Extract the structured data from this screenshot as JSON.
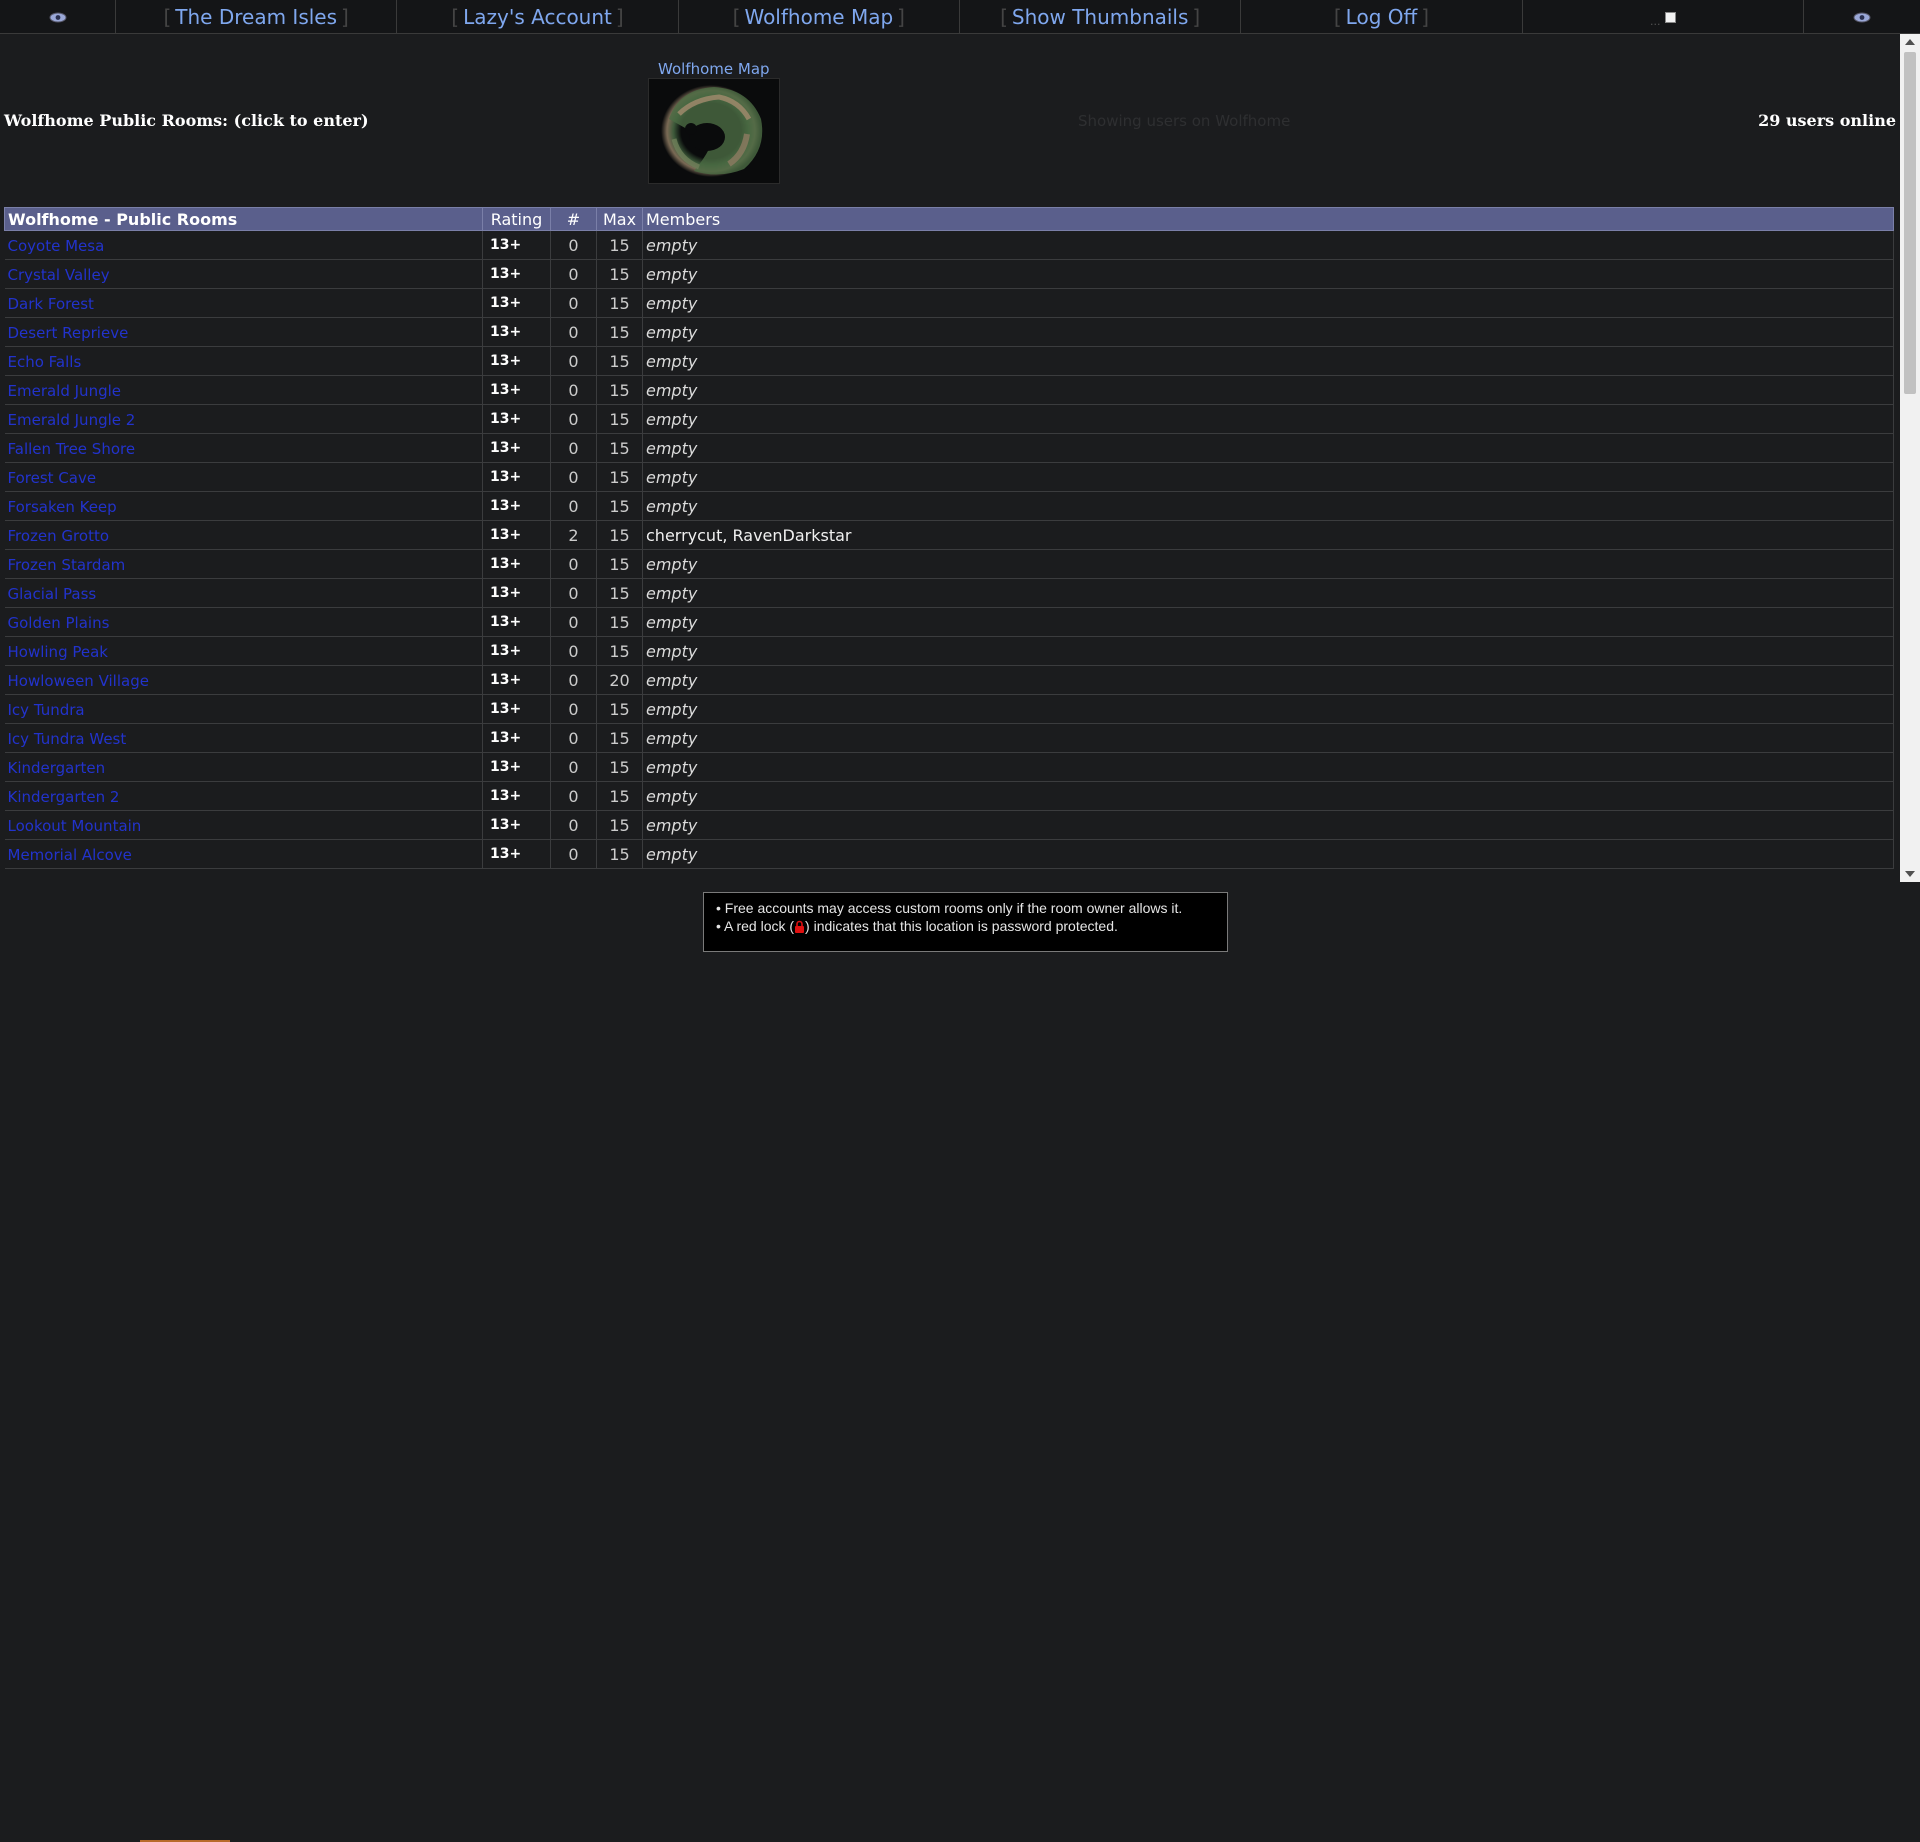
{
  "nav": {
    "items": [
      {
        "label": "The Dream Isles"
      },
      {
        "label": "Lazy's Account"
      },
      {
        "label": "Wolfhome Map"
      },
      {
        "label": "Show Thumbnails"
      },
      {
        "label": "Log Off"
      }
    ],
    "left_icon": "eye-icon",
    "right_icon": "eye-icon",
    "checkbox_dots": "..."
  },
  "header": {
    "public_rooms_title": "Wolfhome Public Rooms: (click to enter)",
    "map_link": "Wolfhome Map",
    "showing_text": "Showing users on Wolfhome",
    "users_online": "29 users online"
  },
  "table": {
    "columns": [
      "Wolfhome - Public Rooms",
      "Rating",
      "#",
      "Max",
      "Members"
    ],
    "rows": [
      {
        "name": "Coyote Mesa",
        "rating": "13+",
        "count": "0",
        "max": "15",
        "members": "empty"
      },
      {
        "name": "Crystal Valley",
        "rating": "13+",
        "count": "0",
        "max": "15",
        "members": "empty"
      },
      {
        "name": "Dark Forest",
        "rating": "13+",
        "count": "0",
        "max": "15",
        "members": "empty"
      },
      {
        "name": "Desert Reprieve",
        "rating": "13+",
        "count": "0",
        "max": "15",
        "members": "empty"
      },
      {
        "name": "Echo Falls",
        "rating": "13+",
        "count": "0",
        "max": "15",
        "members": "empty"
      },
      {
        "name": "Emerald Jungle",
        "rating": "13+",
        "count": "0",
        "max": "15",
        "members": "empty"
      },
      {
        "name": "Emerald Jungle 2",
        "rating": "13+",
        "count": "0",
        "max": "15",
        "members": "empty"
      },
      {
        "name": "Fallen Tree Shore",
        "rating": "13+",
        "count": "0",
        "max": "15",
        "members": "empty"
      },
      {
        "name": "Forest Cave",
        "rating": "13+",
        "count": "0",
        "max": "15",
        "members": "empty"
      },
      {
        "name": "Forsaken Keep",
        "rating": "13+",
        "count": "0",
        "max": "15",
        "members": "empty"
      },
      {
        "name": "Frozen Grotto",
        "rating": "13+",
        "count": "2",
        "max": "15",
        "members": "cherrycut, RavenDarkstar"
      },
      {
        "name": "Frozen Stardam",
        "rating": "13+",
        "count": "0",
        "max": "15",
        "members": "empty"
      },
      {
        "name": "Glacial Pass",
        "rating": "13+",
        "count": "0",
        "max": "15",
        "members": "empty"
      },
      {
        "name": "Golden Plains",
        "rating": "13+",
        "count": "0",
        "max": "15",
        "members": "empty"
      },
      {
        "name": "Howling Peak",
        "rating": "13+",
        "count": "0",
        "max": "15",
        "members": "empty"
      },
      {
        "name": "Howloween Village",
        "rating": "13+",
        "count": "0",
        "max": "20",
        "members": "empty"
      },
      {
        "name": "Icy Tundra",
        "rating": "13+",
        "count": "0",
        "max": "15",
        "members": "empty"
      },
      {
        "name": "Icy Tundra West",
        "rating": "13+",
        "count": "0",
        "max": "15",
        "members": "empty"
      },
      {
        "name": "Kindergarten",
        "rating": "13+",
        "count": "0",
        "max": "15",
        "members": "empty"
      },
      {
        "name": "Kindergarten 2",
        "rating": "13+",
        "count": "0",
        "max": "15",
        "members": "empty"
      },
      {
        "name": "Lookout Mountain",
        "rating": "13+",
        "count": "0",
        "max": "15",
        "members": "empty"
      },
      {
        "name": "Memorial Alcove",
        "rating": "13+",
        "count": "0",
        "max": "15",
        "members": "empty"
      }
    ]
  },
  "notes": {
    "line1": "• Free accounts may access custom rooms only if the room owner allows it.",
    "line2_prefix": "• A red lock (",
    "line2_suffix": ") indicates that this location is password protected.",
    "lock_icon": "lock-icon",
    "lock_color": "#e01010"
  },
  "colors": {
    "link": "#7fa7ee",
    "room_link": "#2233cc",
    "header_bg": "#5a5f8c",
    "page_bg": "#1b1c1e"
  }
}
